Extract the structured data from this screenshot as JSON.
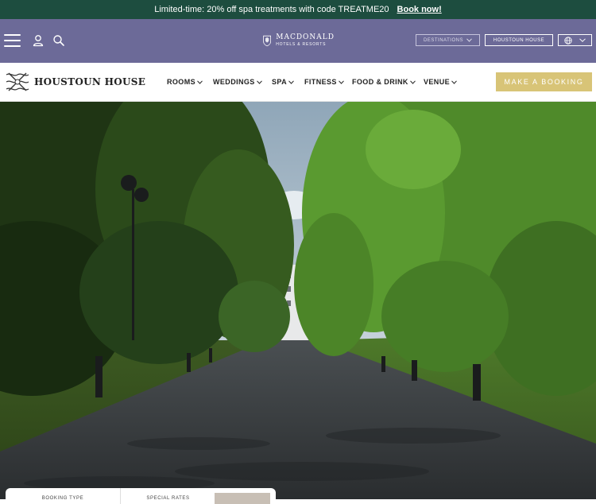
{
  "promo": {
    "text": "Limited-time: 20% off spa treatments with code TREATME20",
    "link_label": "Book now!"
  },
  "header": {
    "brand_name": "MACDONALD",
    "brand_sub": "HOTELS & RESORTS",
    "destinations_label": "DESTINATIONS",
    "hotel_button_label": "HOUSTOUN HOUSE"
  },
  "nav": {
    "hotel_name": "HOUSTOUN HOUSE",
    "items": [
      {
        "label": "ROOMS"
      },
      {
        "label": "WEDDINGS"
      },
      {
        "label": "SPA"
      },
      {
        "label": "FITNESS"
      },
      {
        "label": "FOOD & DRINK"
      },
      {
        "label": "VENUE"
      }
    ],
    "cta_label": "MAKE A BOOKING"
  },
  "booking": {
    "type_label": "BOOKING TYPE",
    "rates_label": "SPECIAL RATES"
  },
  "colors": {
    "promo_bg": "#1d4d3f",
    "header_bg": "#6c6a98",
    "accent_gold": "#d8c477"
  },
  "icons": [
    "menu-icon",
    "user-icon",
    "search-icon",
    "chevron-down-icon",
    "globe-icon",
    "hotel-crest-icon"
  ]
}
